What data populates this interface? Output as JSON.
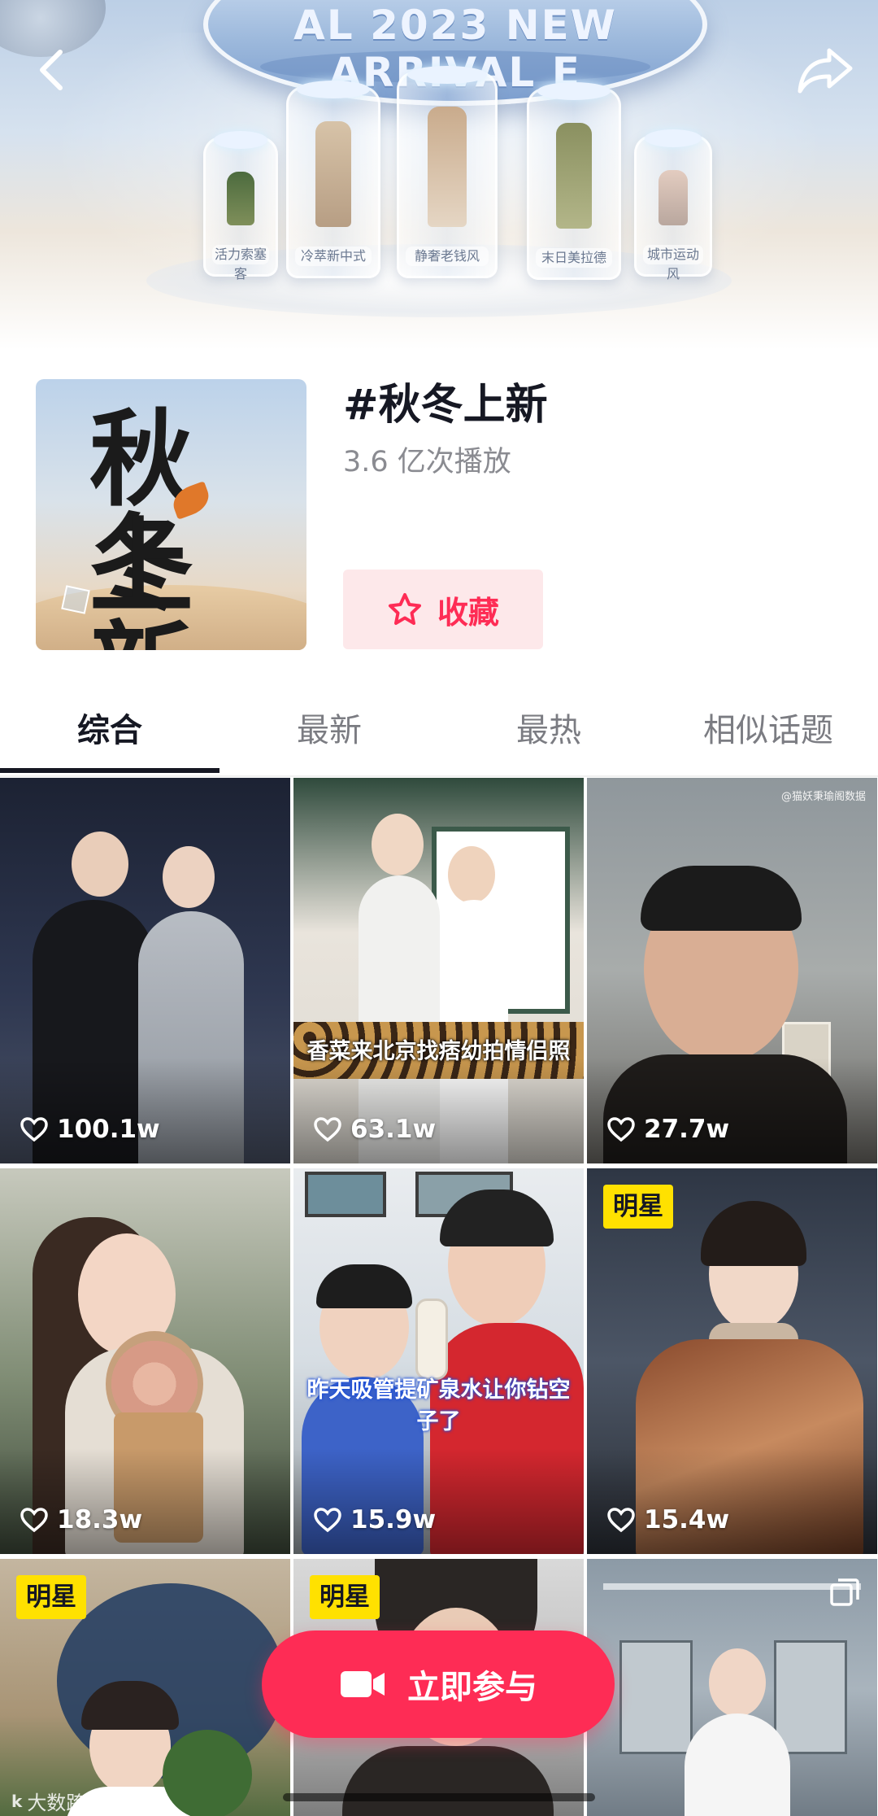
{
  "banner": {
    "ring_text": "AL 2023 NEW ARRIVAL E",
    "tube_tags": [
      "活力索塞客",
      "冷萃新中式",
      "静奢老钱风",
      "末日美拉德",
      "城市运动风"
    ]
  },
  "nav": {
    "back_icon": "chevron-left-icon",
    "share_icon": "share-arrow-icon"
  },
  "cover": {
    "line1": "秋冬",
    "line2": "上新"
  },
  "topic": {
    "title": "#秋冬上新",
    "plays": "3.6 亿次播放",
    "favorite_label": "收藏",
    "favorite_icon": "star-outline-icon"
  },
  "tabs": [
    {
      "label": "综合",
      "active": true
    },
    {
      "label": "最新",
      "active": false
    },
    {
      "label": "最热",
      "active": false
    },
    {
      "label": "相似话题",
      "active": false
    }
  ],
  "videos": [
    {
      "likes": "100.1w"
    },
    {
      "likes": "63.1w",
      "caption": "香菜来北京找痞幼拍情侣照"
    },
    {
      "likes": "27.7w",
      "corner_text": "@猫妖秉瑜阁数据"
    },
    {
      "likes": "18.3w"
    },
    {
      "likes": "15.9w",
      "caption": "昨天吸管提矿泉水让你钻空子了"
    },
    {
      "likes": "15.4w",
      "badge": "明星"
    },
    {
      "badge": "明星"
    },
    {
      "badge": "明星"
    },
    {}
  ],
  "cta": {
    "label": "立即参与",
    "icon": "video-camera-icon"
  },
  "watermark": {
    "logo": "k",
    "text": "大数跨境"
  },
  "colors": {
    "accent": "#fe2c55",
    "accent_light": "#fde8ea",
    "badge": "#ffe100",
    "text_primary": "#161823",
    "text_secondary": "#8a8b91"
  }
}
